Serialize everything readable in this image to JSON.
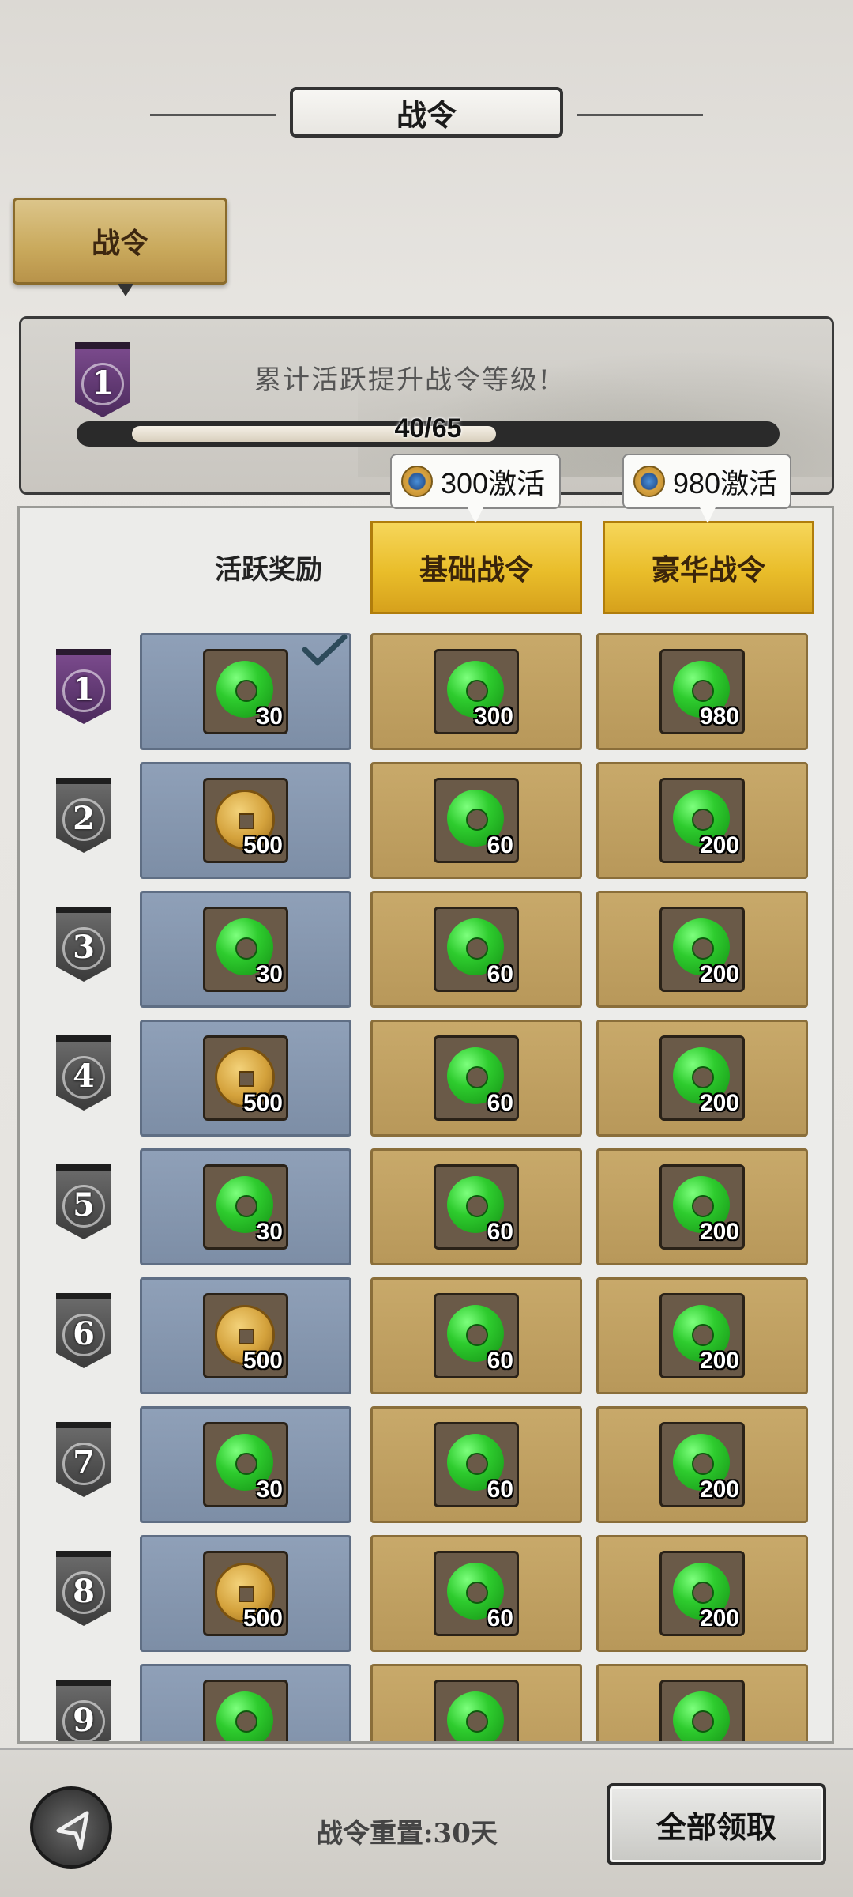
{
  "header": {
    "title": "战令"
  },
  "tab": {
    "label": "战令"
  },
  "level": {
    "current": "1",
    "tip": "累计活跃提升战令等级!",
    "progress_text": "40/65",
    "progress_fraction": 0.615
  },
  "activation": {
    "basic_price": "300激活",
    "luxury_price": "980激活"
  },
  "columns": {
    "free": "活跃奖励",
    "basic": "基础战令",
    "luxury": "豪华战令"
  },
  "rows": [
    {
      "level": "1",
      "free": {
        "type": "jade",
        "qty": "30",
        "claimed": true
      },
      "basic": {
        "type": "jade",
        "qty": "300"
      },
      "luxury": {
        "type": "jade",
        "qty": "980"
      }
    },
    {
      "level": "2",
      "free": {
        "type": "coin",
        "qty": "500"
      },
      "basic": {
        "type": "jade",
        "qty": "60"
      },
      "luxury": {
        "type": "jade",
        "qty": "200"
      }
    },
    {
      "level": "3",
      "free": {
        "type": "jade",
        "qty": "30"
      },
      "basic": {
        "type": "jade",
        "qty": "60"
      },
      "luxury": {
        "type": "jade",
        "qty": "200"
      }
    },
    {
      "level": "4",
      "free": {
        "type": "coin",
        "qty": "500"
      },
      "basic": {
        "type": "jade",
        "qty": "60"
      },
      "luxury": {
        "type": "jade",
        "qty": "200"
      }
    },
    {
      "level": "5",
      "free": {
        "type": "jade",
        "qty": "30"
      },
      "basic": {
        "type": "jade",
        "qty": "60"
      },
      "luxury": {
        "type": "jade",
        "qty": "200"
      }
    },
    {
      "level": "6",
      "free": {
        "type": "coin",
        "qty": "500"
      },
      "basic": {
        "type": "jade",
        "qty": "60"
      },
      "luxury": {
        "type": "jade",
        "qty": "200"
      }
    },
    {
      "level": "7",
      "free": {
        "type": "jade",
        "qty": "30"
      },
      "basic": {
        "type": "jade",
        "qty": "60"
      },
      "luxury": {
        "type": "jade",
        "qty": "200"
      }
    },
    {
      "level": "8",
      "free": {
        "type": "coin",
        "qty": "500"
      },
      "basic": {
        "type": "jade",
        "qty": "60"
      },
      "luxury": {
        "type": "jade",
        "qty": "200"
      }
    },
    {
      "level": "9",
      "free": {
        "type": "jade",
        "qty": ""
      },
      "basic": {
        "type": "jade",
        "qty": ""
      },
      "luxury": {
        "type": "jade",
        "qty": ""
      }
    }
  ],
  "footer": {
    "reset_text": "战令重置:30天",
    "claim_all": "全部领取"
  },
  "icons": {
    "back": "back-arrow-icon",
    "jade": "jade-disc-icon",
    "coin": "copper-coin-icon",
    "gem": "blue-gem-coin-icon",
    "check": "checkmark-icon"
  }
}
